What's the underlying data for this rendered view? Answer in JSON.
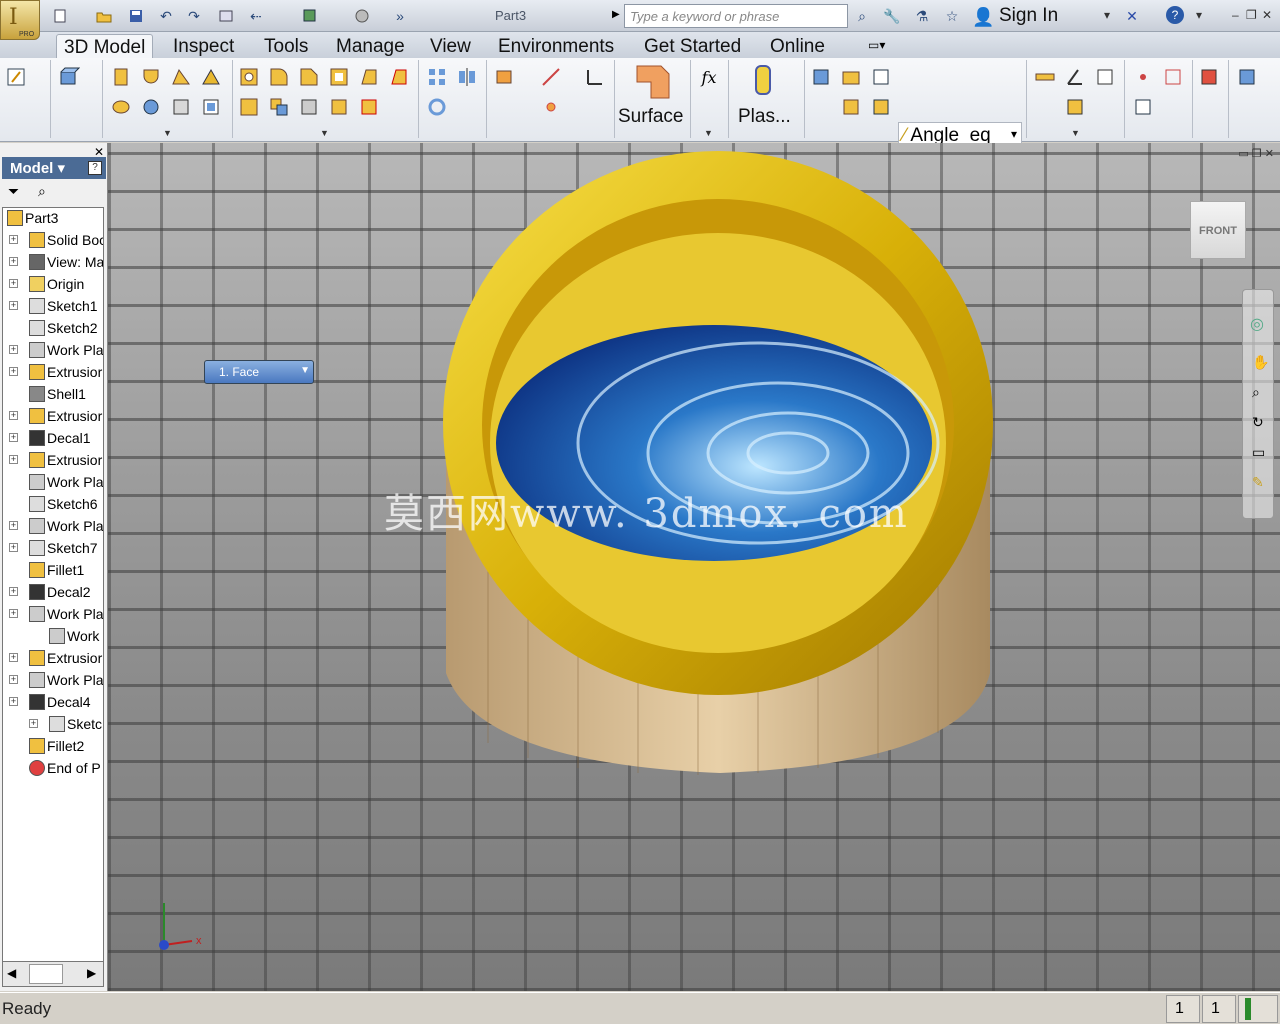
{
  "titlebar": {
    "document_title": "Part3",
    "search_placeholder": "Type a keyword or phrase",
    "sign_in": "Sign In",
    "app_badge": "PRO"
  },
  "tabs": [
    "3D Model",
    "Inspect",
    "Tools",
    "Manage",
    "View",
    "Environments",
    "Get Started",
    "Online"
  ],
  "ribbon": {
    "surface_label": "Surface",
    "plastic_label": "Plas...",
    "angle_combo": "Angle_eq",
    "fx_label": "fx"
  },
  "browser": {
    "title": "Model",
    "nodes": [
      {
        "label": "Part3",
        "icon": "part-icon"
      },
      {
        "label": "Solid Boc",
        "icon": "solid-bodies-icon"
      },
      {
        "label": "View: Ma",
        "icon": "view-rep-icon"
      },
      {
        "label": "Origin",
        "icon": "folder-icon"
      },
      {
        "label": "Sketch1",
        "icon": "sketch-icon"
      },
      {
        "label": "Sketch2",
        "icon": "sketch-icon"
      },
      {
        "label": "Work Pla",
        "icon": "work-plane-icon"
      },
      {
        "label": "Extrusior",
        "icon": "extrusion-icon"
      },
      {
        "label": "Shell1",
        "icon": "shell-icon"
      },
      {
        "label": "Extrusior",
        "icon": "extrusion-icon"
      },
      {
        "label": "Decal1",
        "icon": "decal-icon"
      },
      {
        "label": "Extrusior",
        "icon": "extrusion-icon"
      },
      {
        "label": "Work Pla",
        "icon": "work-plane-icon"
      },
      {
        "label": "Sketch6",
        "icon": "sketch-icon"
      },
      {
        "label": "Work Pla",
        "icon": "work-plane-icon"
      },
      {
        "label": "Sketch7",
        "icon": "sketch-icon"
      },
      {
        "label": "Fillet1",
        "icon": "fillet-icon"
      },
      {
        "label": "Decal2",
        "icon": "decal-icon"
      },
      {
        "label": "Work Pla",
        "icon": "work-plane-icon"
      },
      {
        "label": "Work",
        "icon": "work-plane-icon"
      },
      {
        "label": "Extrusior",
        "icon": "extrusion-icon"
      },
      {
        "label": "Work Pla",
        "icon": "work-plane-icon"
      },
      {
        "label": "Decal4",
        "icon": "decal-icon"
      },
      {
        "label": "Sketc",
        "icon": "sketch-icon"
      },
      {
        "label": "Fillet2",
        "icon": "fillet-icon"
      },
      {
        "label": "End of P",
        "icon": "end-of-part-icon"
      }
    ]
  },
  "viewport": {
    "selection_dropdown": "1. Face",
    "viewcube_face": "FRONT",
    "watermark": "莫西网www. 3dmox. com",
    "axis_x": "x"
  },
  "status": {
    "text": "Ready",
    "count1": "1",
    "count2": "1"
  },
  "colors": {
    "rim_gold": "#d8b008",
    "wood": "#d8b890",
    "water_blue": "#2a78c8",
    "browser_header": "#4b6b95"
  }
}
